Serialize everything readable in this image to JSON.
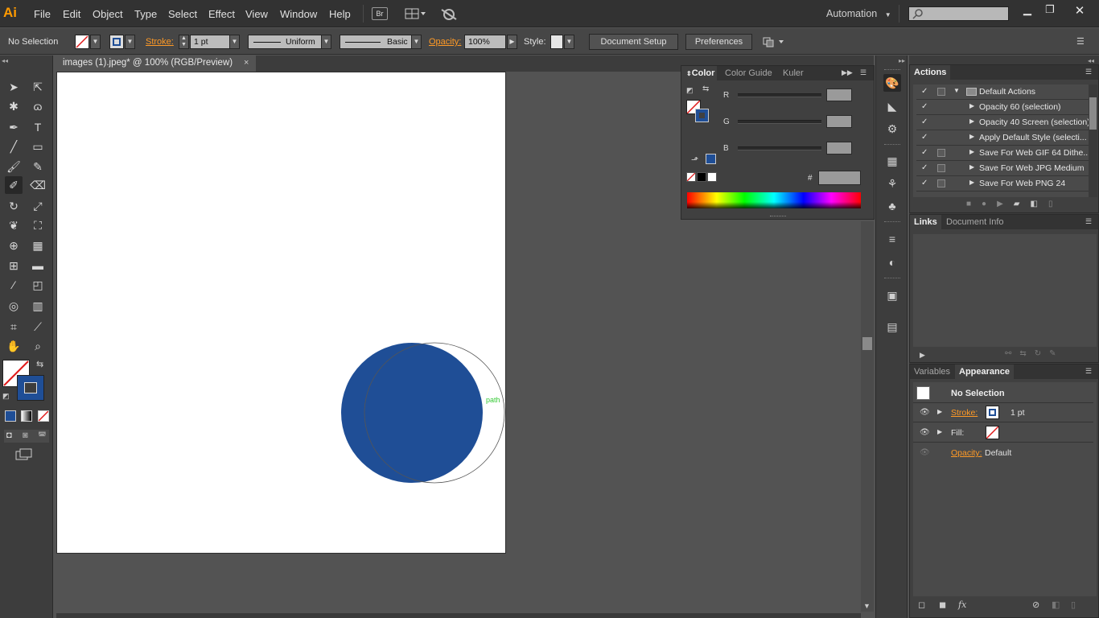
{
  "app": {
    "logo": "Ai"
  },
  "menu": [
    "File",
    "Edit",
    "Object",
    "Type",
    "Select",
    "Effect",
    "View",
    "Window",
    "Help"
  ],
  "menubar_icons": {
    "bridge": "Br",
    "arrange": "arrange-documents-icon",
    "gpu": "gpu-performance-icon"
  },
  "workspace": {
    "label": "Automation"
  },
  "search": {
    "placeholder": ""
  },
  "control_bar": {
    "selection": "No Selection",
    "stroke_label": "Stroke:",
    "stroke_weight": "1 pt",
    "profile": "Uniform",
    "brush": "Basic",
    "opacity_label": "Opacity:",
    "opacity_value": "100%",
    "style_label": "Style:",
    "document_setup": "Document Setup",
    "preferences": "Preferences"
  },
  "document": {
    "tab_title": "images (1).jpeg* @ 100% (RGB/Preview)",
    "close": "×"
  },
  "canvas": {
    "hint_label": "path",
    "fill_color": "#1f4e96"
  },
  "color_panel": {
    "tabs": [
      "Color",
      "Color Guide",
      "Kuler"
    ],
    "r_label": "R",
    "g_label": "G",
    "b_label": "B",
    "hex_label": "#"
  },
  "actions_panel": {
    "title": "Actions",
    "set_name": "Default Actions",
    "items": [
      "Opacity 60 (selection)",
      "Opacity 40 Screen (selection)",
      "Apply Default Style (selecti...",
      "Save For Web GIF 64 Dithe...",
      "Save For Web JPG Medium",
      "Save For Web PNG 24"
    ]
  },
  "links_panel": {
    "tabs": [
      "Links",
      "Document Info"
    ]
  },
  "appearance_panel": {
    "tabs": [
      "Variables",
      "Appearance"
    ],
    "header": "No Selection",
    "stroke_label": "Stroke:",
    "stroke_value": "1 pt",
    "fill_label": "Fill:",
    "opacity_label": "Opacity:",
    "opacity_value": "Default"
  },
  "colors": {
    "accent_orange": "#ff9a26",
    "stroke_blue": "#1f4e96"
  }
}
